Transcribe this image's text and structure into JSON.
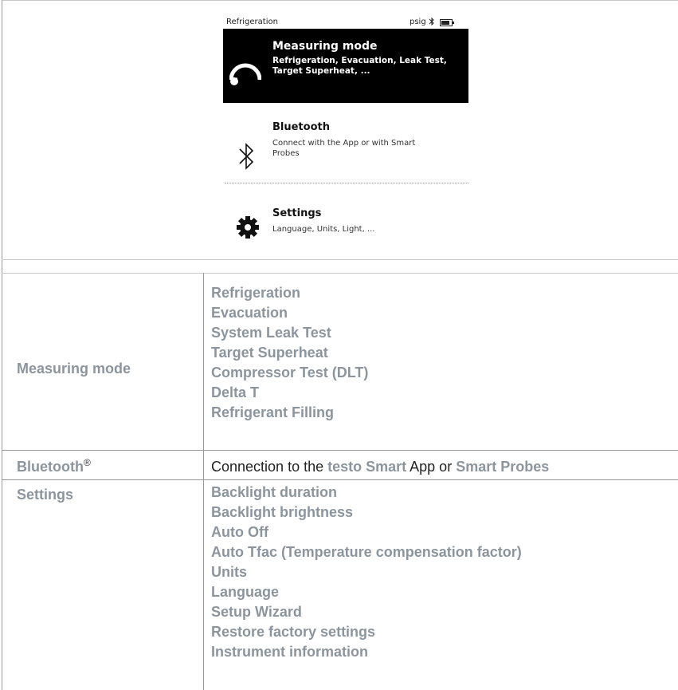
{
  "device": {
    "status_app": "Refrigeration",
    "status_unit": "psig",
    "menu": [
      {
        "title": "Measuring mode",
        "desc": "Refrigeration, Evacuation, Leak Test, Target Superheat, ..."
      },
      {
        "title": "Bluetooth",
        "desc": "Connect with the App or with Smart Probes"
      },
      {
        "title": "Settings",
        "desc": "Language, Units, Light, ..."
      }
    ]
  },
  "table": {
    "measuring_mode": {
      "label": "Measuring mode",
      "items": [
        "Refrigeration",
        "Evacuation",
        "System Leak Test",
        "Target Superheat",
        "Compressor Test (DLT)",
        "Delta T",
        "Refrigerant Filling"
      ]
    },
    "bluetooth": {
      "label": "Bluetooth",
      "reg": "®",
      "text1": "Connection to the ",
      "link1": "testo Smart",
      "text2": " App or ",
      "link2": "Smart Probes"
    },
    "settings": {
      "label": "Settings",
      "items": [
        "Backlight duration",
        "Backlight brightness",
        "Auto Off",
        "Auto Tfac (Temperature compensation factor)",
        "Units",
        "Language",
        "Setup Wizard",
        "Restore factory settings",
        "Instrument information"
      ]
    }
  },
  "colors": {
    "highlight": "#8c959e",
    "device_bg_selected": "#000000"
  },
  "icons": [
    "bluetooth-icon",
    "battery-icon",
    "gauge-icon",
    "gear-icon"
  ]
}
